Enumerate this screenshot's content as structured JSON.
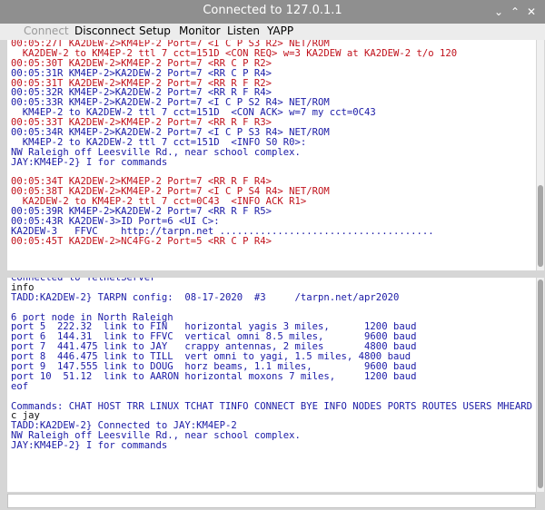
{
  "window": {
    "title": "Connected to 127.0.1.1",
    "controls": {
      "minimize": "⌄",
      "maximize": "⌃",
      "close": "✕"
    }
  },
  "menu": {
    "items": [
      {
        "label": "Connect",
        "enabled": false
      },
      {
        "label": "Disconnect",
        "enabled": true
      },
      {
        "label": "Setup",
        "enabled": true
      },
      {
        "label": "Monitor",
        "enabled": true
      },
      {
        "label": "Listen",
        "enabled": true
      },
      {
        "label": "YAPP",
        "enabled": true
      }
    ]
  },
  "colors": {
    "blue": "#1a1aa6",
    "red": "#c0111b",
    "black": "#111111"
  },
  "monitor_lines": [
    {
      "text": "00:05:27T KA2DEW-2>KM4EP-2 Port=7 <I C P S3 R2> NET/ROM",
      "color": "red"
    },
    {
      "text": "  KA2DEW-2 to KM4EP-2 ttl 7 cct=151D <CON REQ> w=3 KA2DEW at KA2DEW-2 t/o 120",
      "color": "red"
    },
    {
      "text": "00:05:30T KA2DEW-2>KM4EP-2 Port=7 <RR C P R2>",
      "color": "red"
    },
    {
      "text": "00:05:31R KM4EP-2>KA2DEW-2 Port=7 <RR C P R4>",
      "color": "blue"
    },
    {
      "text": "00:05:31T KA2DEW-2>KM4EP-2 Port=7 <RR R F R2>",
      "color": "red"
    },
    {
      "text": "00:05:32R KM4EP-2>KA2DEW-2 Port=7 <RR R F R4>",
      "color": "blue"
    },
    {
      "text": "00:05:33R KM4EP-2>KA2DEW-2 Port=7 <I C P S2 R4> NET/ROM",
      "color": "blue"
    },
    {
      "text": "  KM4EP-2 to KA2DEW-2 ttl 7 cct=151D  <CON ACK> w=7 my cct=0C43",
      "color": "blue"
    },
    {
      "text": "00:05:33T KA2DEW-2>KM4EP-2 Port=7 <RR R F R3>",
      "color": "red"
    },
    {
      "text": "00:05:34R KM4EP-2>KA2DEW-2 Port=7 <I C P S3 R4> NET/ROM",
      "color": "blue"
    },
    {
      "text": "  KM4EP-2 to KA2DEW-2 ttl 7 cct=151D  <INFO S0 R0>:",
      "color": "blue"
    },
    {
      "text": "NW Raleigh off Leesville Rd., near school complex.",
      "color": "blue"
    },
    {
      "text": "JAY:KM4EP-2} I for commands",
      "color": "blue"
    },
    {
      "text": "",
      "color": "blue"
    },
    {
      "text": "00:05:34T KA2DEW-2>KM4EP-2 Port=7 <RR R F R4>",
      "color": "red"
    },
    {
      "text": "00:05:38T KA2DEW-2>KM4EP-2 Port=7 <I C P S4 R4> NET/ROM",
      "color": "red"
    },
    {
      "text": "  KA2DEW-2 to KM4EP-2 ttl 7 cct=0C43  <INFO ACK R1>",
      "color": "red"
    },
    {
      "text": "00:05:39R KM4EP-2>KA2DEW-2 Port=7 <RR R F R5>",
      "color": "blue"
    },
    {
      "text": "00:05:43R KA2DEW-3>ID Port=6 <UI C>:",
      "color": "blue"
    },
    {
      "text": "KA2DEW-3   FFVC    http://tarpn.net .....................................",
      "color": "blue"
    },
    {
      "text": "00:05:45T KA2DEW-2>NC4FG-2 Port=5 <RR C P R4>",
      "color": "red"
    }
  ],
  "terminal_lines": [
    {
      "text": "Connected to TelnetServer",
      "color": "blue"
    },
    {
      "text": "info",
      "color": "black"
    },
    {
      "text": "TADD:KA2DEW-2} TARPN config:  08-17-2020  #3     /tarpn.net/apr2020",
      "color": "blue"
    },
    {
      "text": "",
      "color": "blue"
    },
    {
      "text": "6 port node in North Raleigh",
      "color": "blue"
    },
    {
      "text": "port 5  222.32  link to FIN   horizontal yagis 3 miles,      1200 baud",
      "color": "blue"
    },
    {
      "text": "port 6  144.31  link to FFVC  vertical omni 8.5 miles,       9600 baud",
      "color": "blue"
    },
    {
      "text": "port 7  441.475 link to JAY   crappy antennas, 2 miles       4800 baud",
      "color": "blue"
    },
    {
      "text": "port 8  446.475 link to TILL  vert omni to yagi, 1.5 miles, 4800 baud",
      "color": "blue"
    },
    {
      "text": "port 9  147.555 link to DOUG  horz beams, 1.1 miles,         9600 baud",
      "color": "blue"
    },
    {
      "text": "port 10  51.12  link to AARON horizontal moxons 7 miles,     1200 baud",
      "color": "blue"
    },
    {
      "text": "eof",
      "color": "blue"
    },
    {
      "text": "",
      "color": "blue"
    },
    {
      "text": "Commands: CHAT HOST TRR LINUX TCHAT TINFO CONNECT BYE INFO NODES PORTS ROUTES USERS MHEARD",
      "color": "blue"
    },
    {
      "text": "c jay",
      "color": "black"
    },
    {
      "text": "TADD:KA2DEW-2} Connected to JAY:KM4EP-2",
      "color": "blue"
    },
    {
      "text": "NW Raleigh off Leesville Rd., near school complex.",
      "color": "blue"
    },
    {
      "text": "JAY:KM4EP-2} I for commands",
      "color": "blue"
    }
  ],
  "input": {
    "value": ""
  }
}
